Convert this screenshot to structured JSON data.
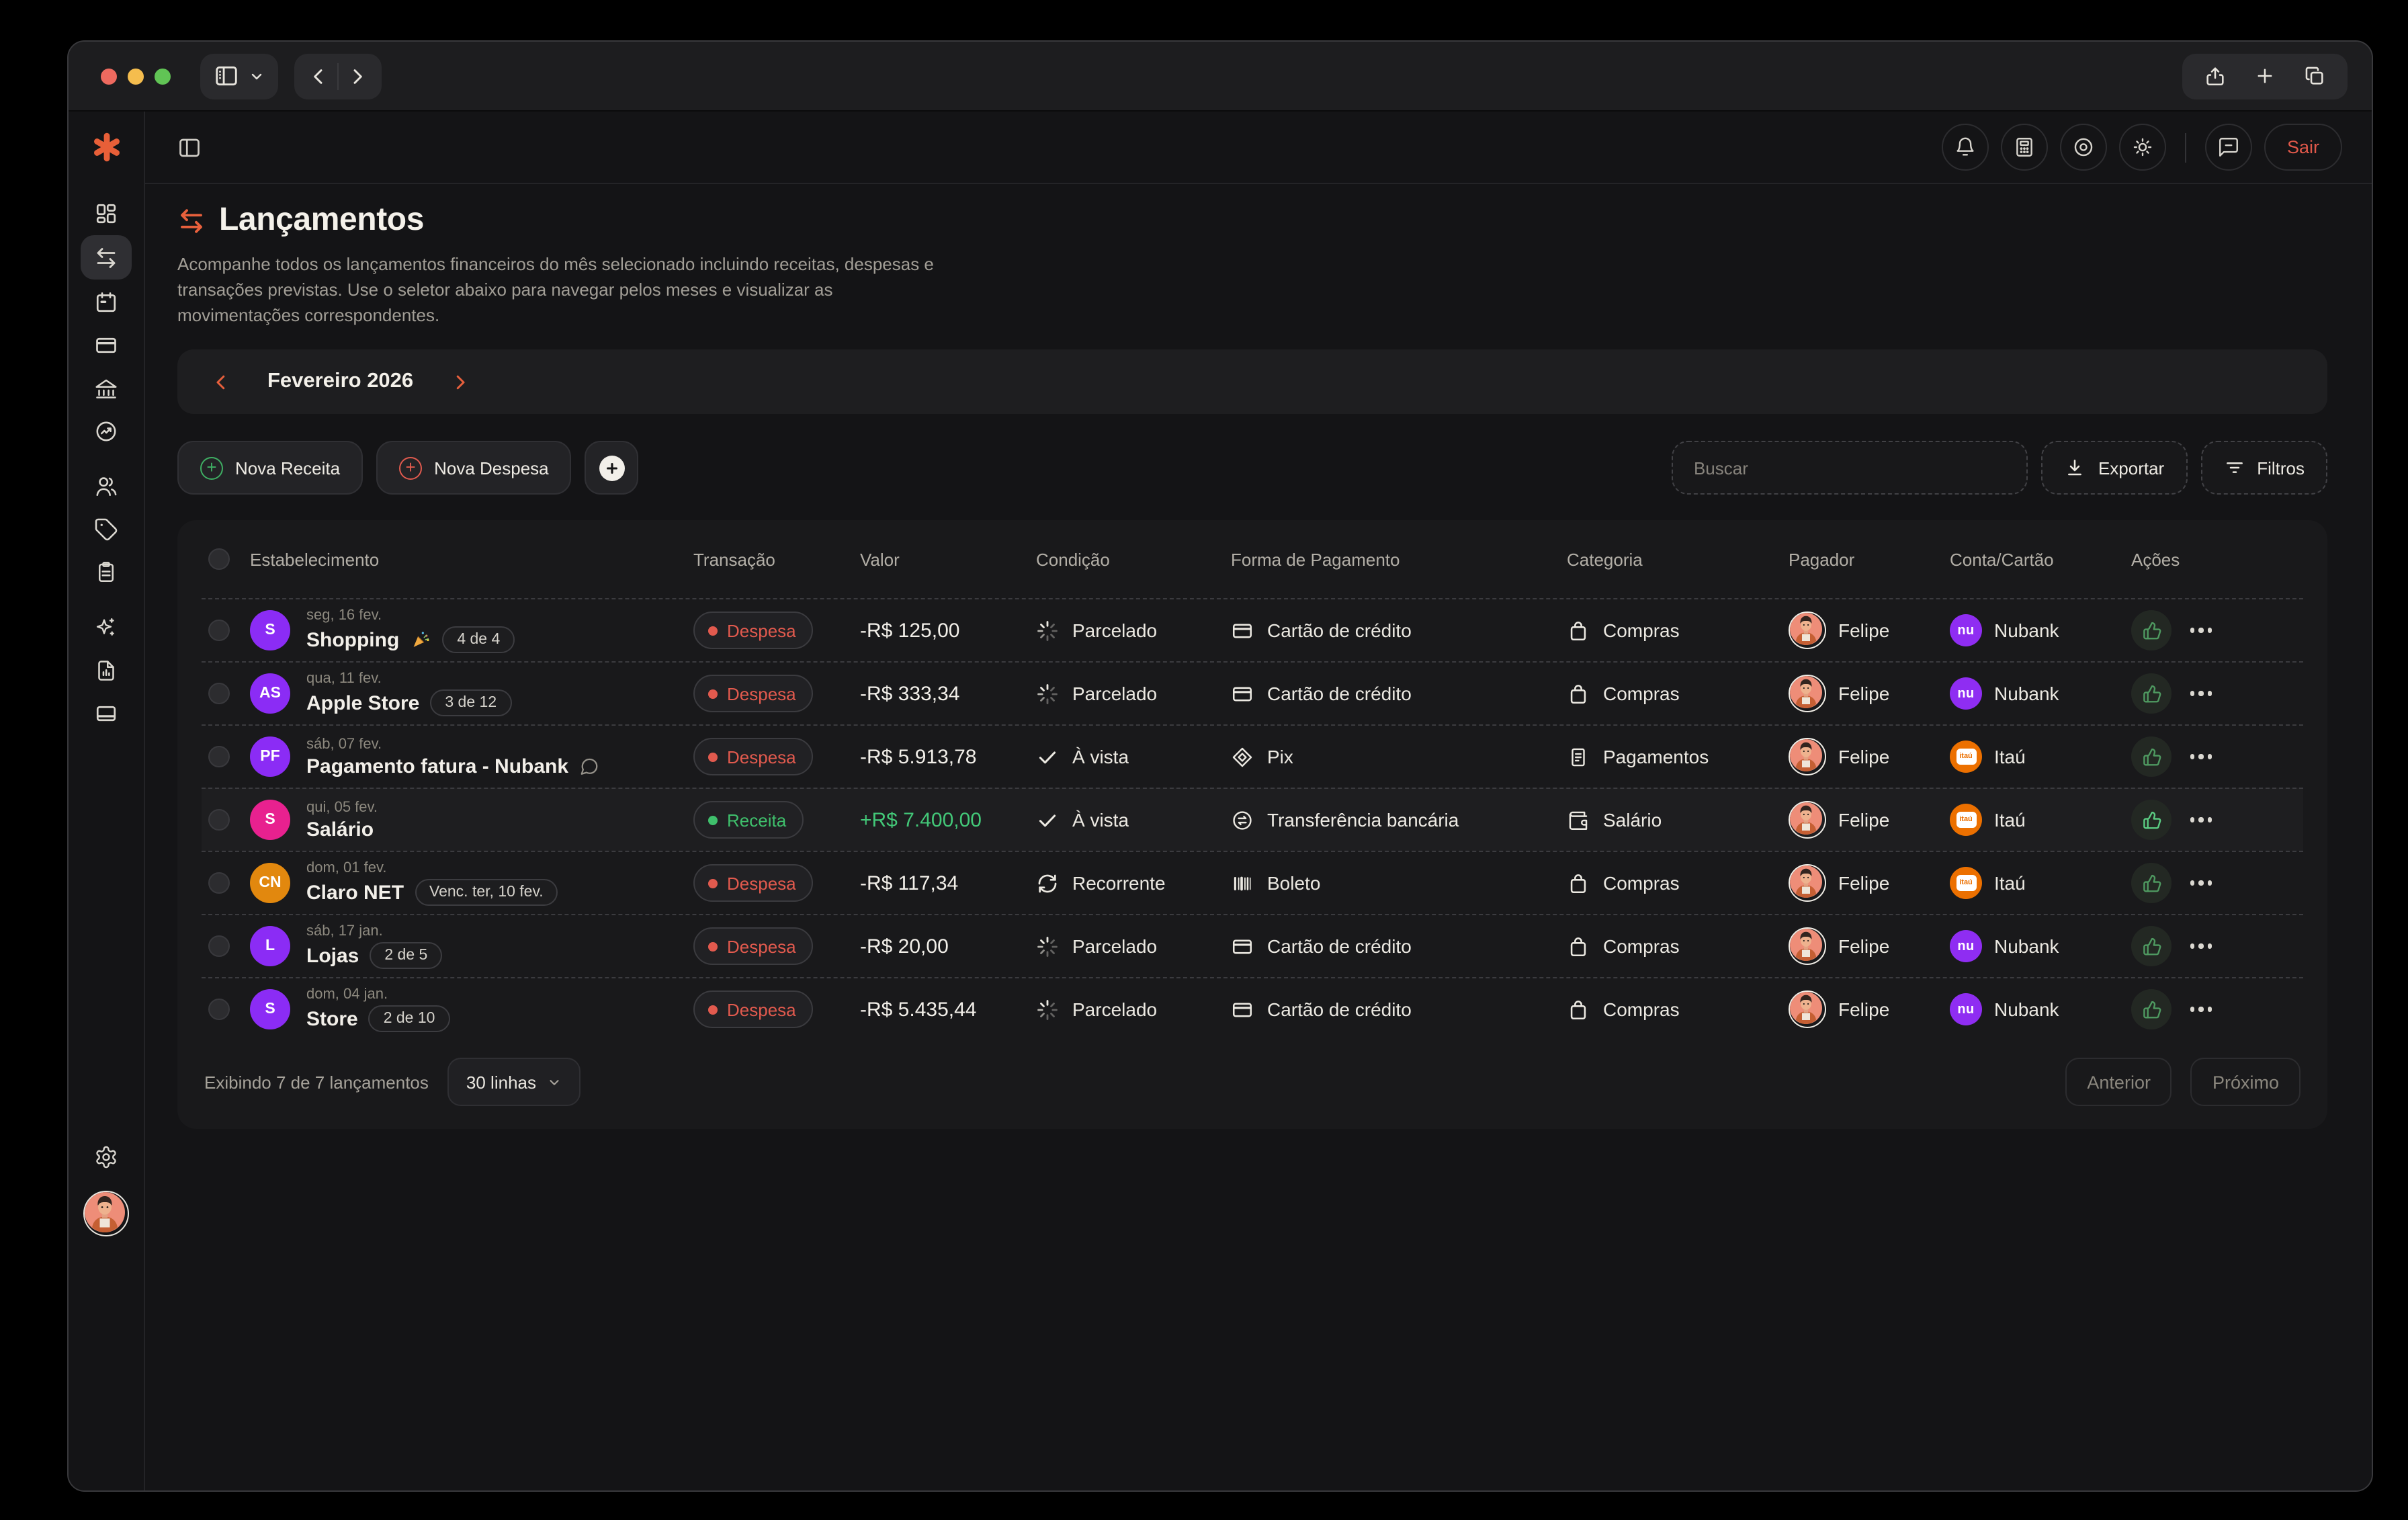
{
  "app_header": {
    "logout_label": "Sair"
  },
  "page": {
    "title": "Lançamentos",
    "description": "Acompanhe todos os lançamentos financeiros do mês selecionado incluindo receitas, despesas e transações previstas. Use o seletor abaixo para navegar pelos meses e visualizar as movimentações correspondentes.",
    "month_selector": {
      "label": "Fevereiro 2026"
    },
    "toolbar": {
      "new_income": "Nova Receita",
      "new_expense": "Nova Despesa",
      "search_placeholder": "Buscar",
      "export": "Exportar",
      "filters": "Filtros"
    },
    "table": {
      "columns": [
        "Estabelecimento",
        "Transação",
        "Valor",
        "Condição",
        "Forma de Pagamento",
        "Categoria",
        "Pagador",
        "Conta/Cartão",
        "Ações"
      ],
      "rows": [
        {
          "initials": "S",
          "avatar_color": "#8b2cf5",
          "date": "seg, 16 fev.",
          "name": "Shopping",
          "emoji": true,
          "badge": "4 de 4",
          "type": "Despesa",
          "type_color": "despesa",
          "value": "-R$ 125,00",
          "condition": "Parcelado",
          "condition_icon": "loader",
          "payment": "Cartão de crédito",
          "payment_icon": "card",
          "category": "Compras",
          "category_icon": "bag",
          "payer": "Felipe",
          "account": "Nubank",
          "account_logo": "nubank"
        },
        {
          "initials": "AS",
          "avatar_color": "#8b2cf5",
          "date": "qua, 11 fev.",
          "name": "Apple Store",
          "badge": "3 de 12",
          "type": "Despesa",
          "type_color": "despesa",
          "value": "-R$ 333,34",
          "condition": "Parcelado",
          "condition_icon": "loader",
          "payment": "Cartão de crédito",
          "payment_icon": "card",
          "category": "Compras",
          "category_icon": "bag",
          "payer": "Felipe",
          "account": "Nubank",
          "account_logo": "nubank"
        },
        {
          "initials": "PF",
          "avatar_color": "#8b2cf5",
          "date": "sáb, 07 fev.",
          "name": "Pagamento fatura - Nubank",
          "comment": true,
          "type": "Despesa",
          "type_color": "despesa",
          "value": "-R$ 5.913,78",
          "condition": "À vista",
          "condition_icon": "check",
          "payment": "Pix",
          "payment_icon": "pix",
          "category": "Pagamentos",
          "category_icon": "receipt",
          "payer": "Felipe",
          "account": "Itaú",
          "account_logo": "itau"
        },
        {
          "initials": "S",
          "avatar_color": "#e8218f",
          "date": "qui, 05 fev.",
          "name": "Salário",
          "highlight": true,
          "type": "Receita",
          "type_color": "receita",
          "value": "+R$ 7.400,00",
          "condition": "À vista",
          "condition_icon": "check",
          "payment": "Transferência bancária",
          "payment_icon": "transfer",
          "category": "Salário",
          "category_icon": "wallet",
          "payer": "Felipe",
          "account": "Itaú",
          "account_logo": "itau"
        },
        {
          "initials": "CN",
          "avatar_color": "#e2880e",
          "date": "dom, 01 fev.",
          "name": "Claro NET",
          "badge": "Venc. ter, 10 fev.",
          "type": "Despesa",
          "type_color": "despesa",
          "value": "-R$ 117,34",
          "condition": "Recorrente",
          "condition_icon": "refresh",
          "payment": "Boleto",
          "payment_icon": "barcode",
          "category": "Compras",
          "category_icon": "bag",
          "payer": "Felipe",
          "account": "Itaú",
          "account_logo": "itau"
        },
        {
          "initials": "L",
          "avatar_color": "#8b2cf5",
          "date": "sáb, 17 jan.",
          "name": "Lojas",
          "badge": "2 de 5",
          "type": "Despesa",
          "type_color": "despesa",
          "value": "-R$ 20,00",
          "condition": "Parcelado",
          "condition_icon": "loader",
          "payment": "Cartão de crédito",
          "payment_icon": "card",
          "category": "Compras",
          "category_icon": "bag",
          "payer": "Felipe",
          "account": "Nubank",
          "account_logo": "nubank"
        },
        {
          "initials": "S",
          "avatar_color": "#8b2cf5",
          "date": "dom, 04 jan.",
          "name": "Store",
          "badge": "2 de 10",
          "type": "Despesa",
          "type_color": "despesa",
          "value": "-R$ 5.435,44",
          "condition": "Parcelado",
          "condition_icon": "loader",
          "payment": "Cartão de crédito",
          "payment_icon": "card",
          "category": "Compras",
          "category_icon": "bag",
          "payer": "Felipe",
          "account": "Nubank",
          "account_logo": "nubank"
        }
      ],
      "footer": {
        "summary": "Exibindo 7 de 7 lançamentos",
        "page_size": "30 linhas",
        "prev": "Anterior",
        "next": "Próximo"
      }
    }
  },
  "colors": {
    "accent_orange": "#e8603c",
    "expense_red": "#e25a4e",
    "income_green": "#3fc06c",
    "nubank_purple": "#8f2df2",
    "itau_orange": "#ec7000"
  },
  "icons": {
    "sidebar": [
      "dashboard-icon",
      "transactions-icon",
      "calendar-icon",
      "credit-card-icon",
      "bank-icon",
      "chart-icon",
      "users-icon",
      "tag-icon",
      "clipboard-icon",
      "sparkles-icon",
      "report-icon",
      "wallet-card-icon",
      "settings-icon",
      "user-avatar"
    ],
    "header": [
      "bell-icon",
      "calculator-icon",
      "target-icon",
      "sun-icon",
      "chat-icon"
    ]
  }
}
